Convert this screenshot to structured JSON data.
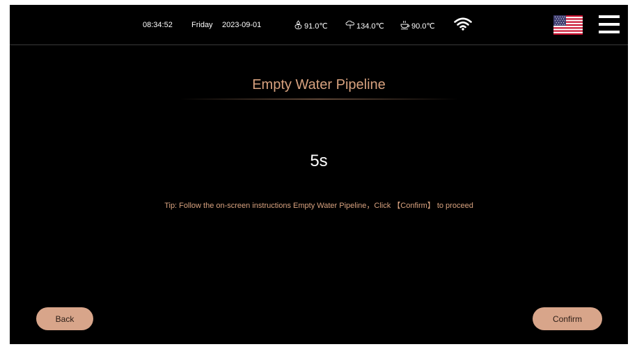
{
  "status_bar": {
    "time": "08:34:52",
    "day": "Friday",
    "date": "2023-09-01",
    "temp_1": "91.0℃",
    "temp_1_icon": "water-heater-icon",
    "temp_2": "134.0℃",
    "temp_2_icon": "steam-icon",
    "temp_3": "90.0℃",
    "temp_3_icon": "coffee-cup-icon",
    "wifi_icon": "wifi-icon",
    "language_flag": "us-flag-icon",
    "menu_icon": "hamburger-menu-icon"
  },
  "page": {
    "title": "Empty Water Pipeline",
    "countdown": "5s",
    "tip": "Tip: Follow the on-screen instructions Empty Water Pipeline，Click 【Confirm】 to proceed"
  },
  "buttons": {
    "back_label": "Back",
    "confirm_label": "Confirm"
  },
  "colors": {
    "background": "#000000",
    "accent": "#d8a27f",
    "button_fill": "#d8a58a",
    "text": "#ffffff"
  }
}
